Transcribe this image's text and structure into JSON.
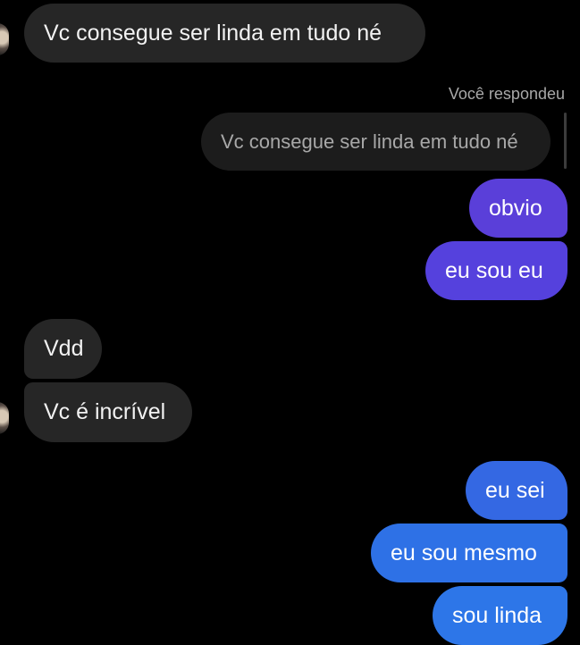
{
  "messages": {
    "m1": "Vc consegue ser linda em tudo né",
    "reply_label": "Você respondeu",
    "reply_quote": "Vc consegue ser linda em tudo né",
    "m2": "obvio",
    "m3": "eu sou eu",
    "m4": "Vdd",
    "m5": "Vc é incrível",
    "m6": "eu sei",
    "m7": "eu sou mesmo",
    "m8": "sou linda"
  },
  "colors": {
    "incoming_bubble": "#262626",
    "outgoing_purple": "#5a3fd9",
    "outgoing_blue": "#2f6fe6"
  }
}
